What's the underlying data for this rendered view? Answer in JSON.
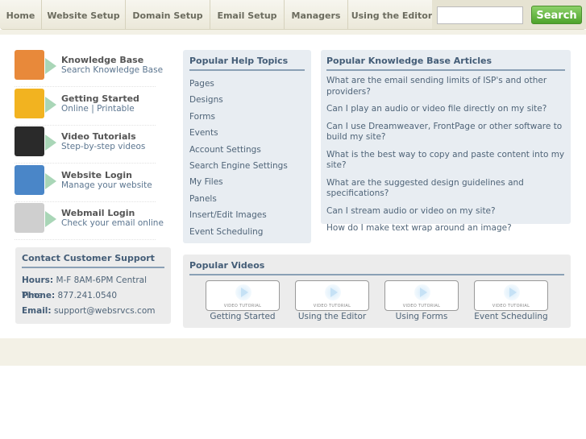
{
  "nav": {
    "items": [
      "Home",
      "Website Setup",
      "Domain Setup",
      "Email Setup",
      "Managers",
      "Using the Editor"
    ],
    "search_value": "",
    "search_label": "Search"
  },
  "quicklinks": [
    {
      "title": "Knowledge Base",
      "sub": "Search Knowledge Base",
      "icon": "info-icon",
      "color": "#e8893a"
    },
    {
      "title": "Getting Started",
      "sub": "Online | Printable",
      "icon": "starburst-arrow-icon",
      "color": "#f2b320"
    },
    {
      "title": "Video Tutorials",
      "sub": "Step-by-step videos",
      "icon": "video-film-icon",
      "color": "#2a2a2a"
    },
    {
      "title": "Website Login",
      "sub": "Manage your website",
      "icon": "globe-window-icon",
      "color": "#4a86c8"
    },
    {
      "title": "Webmail Login",
      "sub": "Check your email online",
      "icon": "envelope-icon",
      "color": "#cfcfcf"
    }
  ],
  "contact": {
    "title": "Contact Customer Support",
    "hours_label": "Hours:",
    "hours": "M-F 8AM-6PM Central Time",
    "phone_label": "Phone:",
    "phone": "877.241.0540",
    "email_label": "Email:",
    "email": "support@websrvcs.com"
  },
  "topics": {
    "title": "Popular Help Topics",
    "items": [
      "Pages",
      "Designs",
      "Forms",
      "Events",
      "Account Settings",
      "Search Engine Settings",
      "My Files",
      "Panels",
      "Insert/Edit Images",
      "Event Scheduling"
    ]
  },
  "kb": {
    "title": "Popular Knowledge Base Articles",
    "items": [
      "What are the email sending limits of ISP's and other providers?",
      "Can I play an audio or video file directly on my site?",
      "Can I use Dreamweaver, FrontPage or other software to build my site?",
      "What is the best way to copy and paste content into my site?",
      "What are the suggested design guidelines and specifications?",
      "Can I stream audio or video on my site?",
      "How do I make text wrap around an image?"
    ]
  },
  "videos": {
    "title": "Popular Videos",
    "thumb_label": "VIDEO TUTORIAL",
    "items": [
      "Getting Started",
      "Using the Editor",
      "Using Forms",
      "Event Scheduling"
    ]
  }
}
